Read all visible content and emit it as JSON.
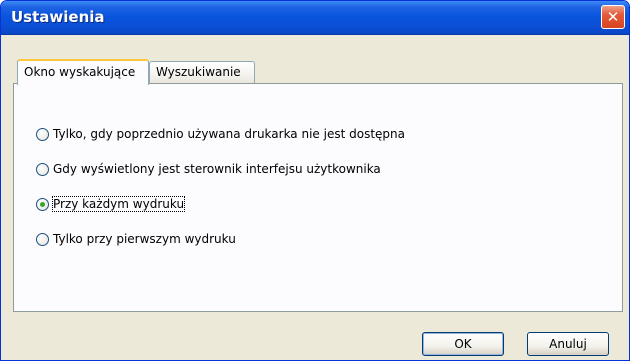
{
  "window": {
    "title": "Ustawienia",
    "close_glyph": "✕"
  },
  "tabs": [
    {
      "label": "Okno wyskakujące",
      "active": true
    },
    {
      "label": "Wyszukiwanie",
      "active": false
    }
  ],
  "options": [
    {
      "label": "Tylko, gdy poprzednio używana drukarka nie jest dostępna",
      "checked": false
    },
    {
      "label": "Gdy wyświetlony jest sterownik interfejsu użytkownika",
      "checked": false
    },
    {
      "label": "Przy każdym wydruku",
      "checked": true
    },
    {
      "label": "Tylko przy pierwszym wydruku",
      "checked": false
    }
  ],
  "buttons": {
    "ok_label": "OK",
    "cancel_label": "Anuluj"
  },
  "colors": {
    "titlebar_blue": "#0a55de",
    "close_red": "#d8431e",
    "tab_highlight": "#ffc73c",
    "radio_check_green": "#2fa728",
    "dialog_background": "#ece9d8"
  },
  "icons": [
    "close-icon"
  ]
}
